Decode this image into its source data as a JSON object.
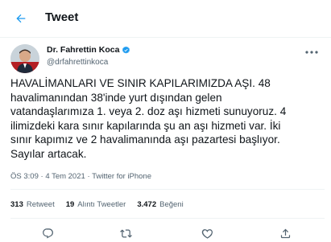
{
  "header": {
    "title": "Tweet",
    "back_icon": "arrow-left-icon"
  },
  "author": {
    "name": "Dr. Fahrettin Koca",
    "handle": "@drfahrettinkoca",
    "verified_icon": "verified-badge-icon"
  },
  "tweet": {
    "lines": [
      "HAVALİMANLARI VE SINIR KAPILARIMIZDA AŞI. 48",
      "havalimanından 38'inde yurt dışından gelen",
      "vatandaşlarımıza 1. veya 2. doz aşı hizmeti sunuyoruz. 4",
      "ilimizdeki kara sınır kapılarında şu an aşı hizmeti var. İki",
      "sınır kapımız ve 2 havalimanında aşı pazartesi başlıyor.",
      "Sayılar artacak."
    ],
    "time": "ÖS 3:09",
    "separator": "·",
    "date": "4 Tem 2021",
    "source": "Twitter for iPhone"
  },
  "stats": {
    "retweets_count": "313",
    "retweets_label": "Retweet",
    "quotes_count": "19",
    "quotes_label": "Alıntı Tweetler",
    "likes_count": "3.472",
    "likes_label": "Beğeni"
  },
  "actions": [
    "reply-icon",
    "retweet-icon",
    "like-icon",
    "share-icon"
  ],
  "colors": {
    "text": "#0f1419",
    "secondary": "#536471",
    "accent": "#1d9bf0",
    "divider": "#eff3f4"
  }
}
